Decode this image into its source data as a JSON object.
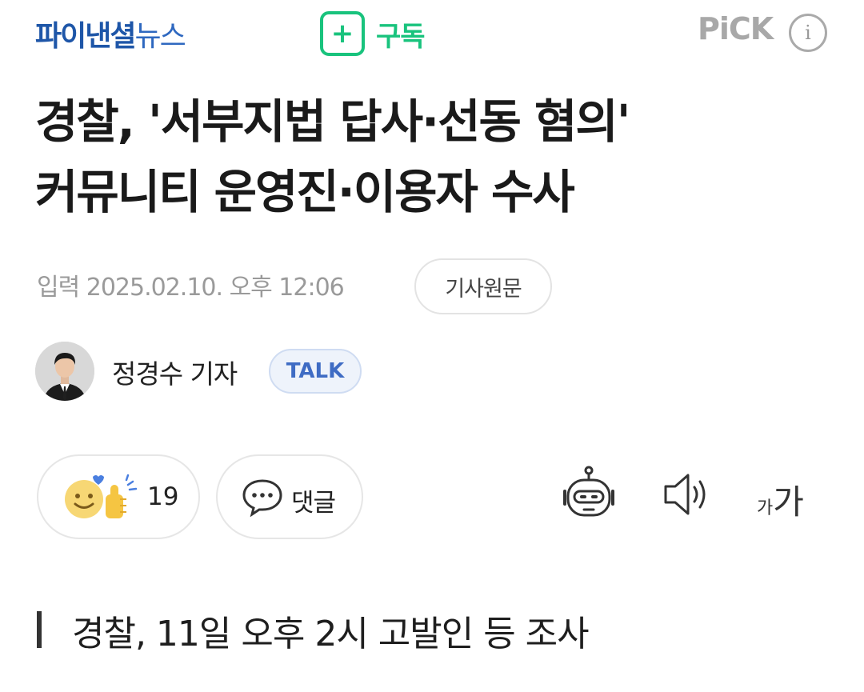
{
  "header": {
    "press_logo_main": "파이낸셜",
    "press_logo_sub": "뉴스",
    "subscribe_label": "구독",
    "pick_label": "PiCK",
    "info_label": "i"
  },
  "article": {
    "title_line1": "경찰, '서부지법 답사·선동 혐의'",
    "title_line2": "커뮤니티 운영진·이용자 수사",
    "dateline": "입력 2025.02.10. 오후 12:06",
    "origin_button": "기사원문",
    "reporter": "정경수 기자",
    "talk_button": "TALK",
    "subheading": "경찰, 11일 오후 2시 고발인 등 조사"
  },
  "actions": {
    "reaction_count": "19",
    "comment_label": "댓글",
    "font_small": "가",
    "font_large": "가"
  },
  "colors": {
    "press_blue": "#1e56a8",
    "subscribe_green": "#19c37d",
    "talk_blue": "#3f6cc4",
    "muted_gray": "#9a9a9a"
  },
  "icons": {
    "subscribe": "plus-icon",
    "reaction": "smile-thumbs-up-icon",
    "comment": "speech-bubble-icon",
    "summary_bot": "robot-icon",
    "read_aloud": "speaker-icon",
    "font_size": "font-size-icon"
  }
}
